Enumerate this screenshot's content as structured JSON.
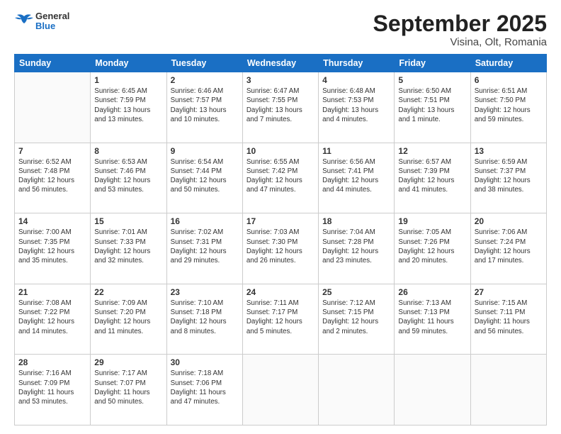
{
  "header": {
    "logo": {
      "line1": "General",
      "line2": "Blue"
    },
    "title": "September 2025",
    "subtitle": "Visina, Olt, Romania"
  },
  "weekdays": [
    "Sunday",
    "Monday",
    "Tuesday",
    "Wednesday",
    "Thursday",
    "Friday",
    "Saturday"
  ],
  "weeks": [
    [
      {
        "day": "",
        "info": ""
      },
      {
        "day": "1",
        "info": "Sunrise: 6:45 AM\nSunset: 7:59 PM\nDaylight: 13 hours\nand 13 minutes."
      },
      {
        "day": "2",
        "info": "Sunrise: 6:46 AM\nSunset: 7:57 PM\nDaylight: 13 hours\nand 10 minutes."
      },
      {
        "day": "3",
        "info": "Sunrise: 6:47 AM\nSunset: 7:55 PM\nDaylight: 13 hours\nand 7 minutes."
      },
      {
        "day": "4",
        "info": "Sunrise: 6:48 AM\nSunset: 7:53 PM\nDaylight: 13 hours\nand 4 minutes."
      },
      {
        "day": "5",
        "info": "Sunrise: 6:50 AM\nSunset: 7:51 PM\nDaylight: 13 hours\nand 1 minute."
      },
      {
        "day": "6",
        "info": "Sunrise: 6:51 AM\nSunset: 7:50 PM\nDaylight: 12 hours\nand 59 minutes."
      }
    ],
    [
      {
        "day": "7",
        "info": "Sunrise: 6:52 AM\nSunset: 7:48 PM\nDaylight: 12 hours\nand 56 minutes."
      },
      {
        "day": "8",
        "info": "Sunrise: 6:53 AM\nSunset: 7:46 PM\nDaylight: 12 hours\nand 53 minutes."
      },
      {
        "day": "9",
        "info": "Sunrise: 6:54 AM\nSunset: 7:44 PM\nDaylight: 12 hours\nand 50 minutes."
      },
      {
        "day": "10",
        "info": "Sunrise: 6:55 AM\nSunset: 7:42 PM\nDaylight: 12 hours\nand 47 minutes."
      },
      {
        "day": "11",
        "info": "Sunrise: 6:56 AM\nSunset: 7:41 PM\nDaylight: 12 hours\nand 44 minutes."
      },
      {
        "day": "12",
        "info": "Sunrise: 6:57 AM\nSunset: 7:39 PM\nDaylight: 12 hours\nand 41 minutes."
      },
      {
        "day": "13",
        "info": "Sunrise: 6:59 AM\nSunset: 7:37 PM\nDaylight: 12 hours\nand 38 minutes."
      }
    ],
    [
      {
        "day": "14",
        "info": "Sunrise: 7:00 AM\nSunset: 7:35 PM\nDaylight: 12 hours\nand 35 minutes."
      },
      {
        "day": "15",
        "info": "Sunrise: 7:01 AM\nSunset: 7:33 PM\nDaylight: 12 hours\nand 32 minutes."
      },
      {
        "day": "16",
        "info": "Sunrise: 7:02 AM\nSunset: 7:31 PM\nDaylight: 12 hours\nand 29 minutes."
      },
      {
        "day": "17",
        "info": "Sunrise: 7:03 AM\nSunset: 7:30 PM\nDaylight: 12 hours\nand 26 minutes."
      },
      {
        "day": "18",
        "info": "Sunrise: 7:04 AM\nSunset: 7:28 PM\nDaylight: 12 hours\nand 23 minutes."
      },
      {
        "day": "19",
        "info": "Sunrise: 7:05 AM\nSunset: 7:26 PM\nDaylight: 12 hours\nand 20 minutes."
      },
      {
        "day": "20",
        "info": "Sunrise: 7:06 AM\nSunset: 7:24 PM\nDaylight: 12 hours\nand 17 minutes."
      }
    ],
    [
      {
        "day": "21",
        "info": "Sunrise: 7:08 AM\nSunset: 7:22 PM\nDaylight: 12 hours\nand 14 minutes."
      },
      {
        "day": "22",
        "info": "Sunrise: 7:09 AM\nSunset: 7:20 PM\nDaylight: 12 hours\nand 11 minutes."
      },
      {
        "day": "23",
        "info": "Sunrise: 7:10 AM\nSunset: 7:18 PM\nDaylight: 12 hours\nand 8 minutes."
      },
      {
        "day": "24",
        "info": "Sunrise: 7:11 AM\nSunset: 7:17 PM\nDaylight: 12 hours\nand 5 minutes."
      },
      {
        "day": "25",
        "info": "Sunrise: 7:12 AM\nSunset: 7:15 PM\nDaylight: 12 hours\nand 2 minutes."
      },
      {
        "day": "26",
        "info": "Sunrise: 7:13 AM\nSunset: 7:13 PM\nDaylight: 11 hours\nand 59 minutes."
      },
      {
        "day": "27",
        "info": "Sunrise: 7:15 AM\nSunset: 7:11 PM\nDaylight: 11 hours\nand 56 minutes."
      }
    ],
    [
      {
        "day": "28",
        "info": "Sunrise: 7:16 AM\nSunset: 7:09 PM\nDaylight: 11 hours\nand 53 minutes."
      },
      {
        "day": "29",
        "info": "Sunrise: 7:17 AM\nSunset: 7:07 PM\nDaylight: 11 hours\nand 50 minutes."
      },
      {
        "day": "30",
        "info": "Sunrise: 7:18 AM\nSunset: 7:06 PM\nDaylight: 11 hours\nand 47 minutes."
      },
      {
        "day": "",
        "info": ""
      },
      {
        "day": "",
        "info": ""
      },
      {
        "day": "",
        "info": ""
      },
      {
        "day": "",
        "info": ""
      }
    ]
  ]
}
